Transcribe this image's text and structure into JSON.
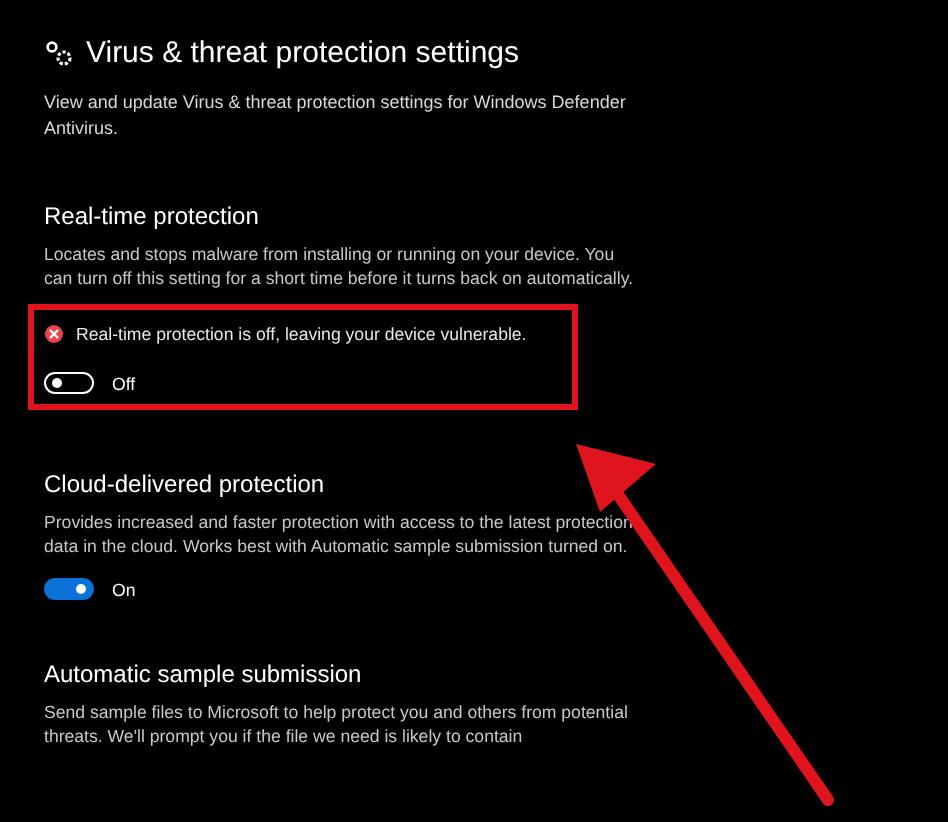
{
  "page": {
    "title": "Virus & threat protection settings",
    "description": "View and update Virus & threat protection settings for Windows Defender Antivirus."
  },
  "sections": [
    {
      "heading": "Real-time protection",
      "description": "Locates and stops malware from installing or running on your device. You can turn off this setting for a short time before it turns back on automatically.",
      "warning": "Real-time protection is off, leaving your device vulnerable.",
      "highlighted": true,
      "toggle": {
        "on": false,
        "label": "Off"
      }
    },
    {
      "heading": "Cloud-delivered protection",
      "description": "Provides increased and faster protection with access to the latest protection data in the cloud. Works best with Automatic sample submission turned on.",
      "highlighted": false,
      "toggle": {
        "on": true,
        "label": "On"
      }
    },
    {
      "heading": "Automatic sample submission",
      "description": "Send sample files to Microsoft to help protect you and others from potential threats. We'll prompt you if the file we need is likely to contain",
      "highlighted": false
    }
  ]
}
